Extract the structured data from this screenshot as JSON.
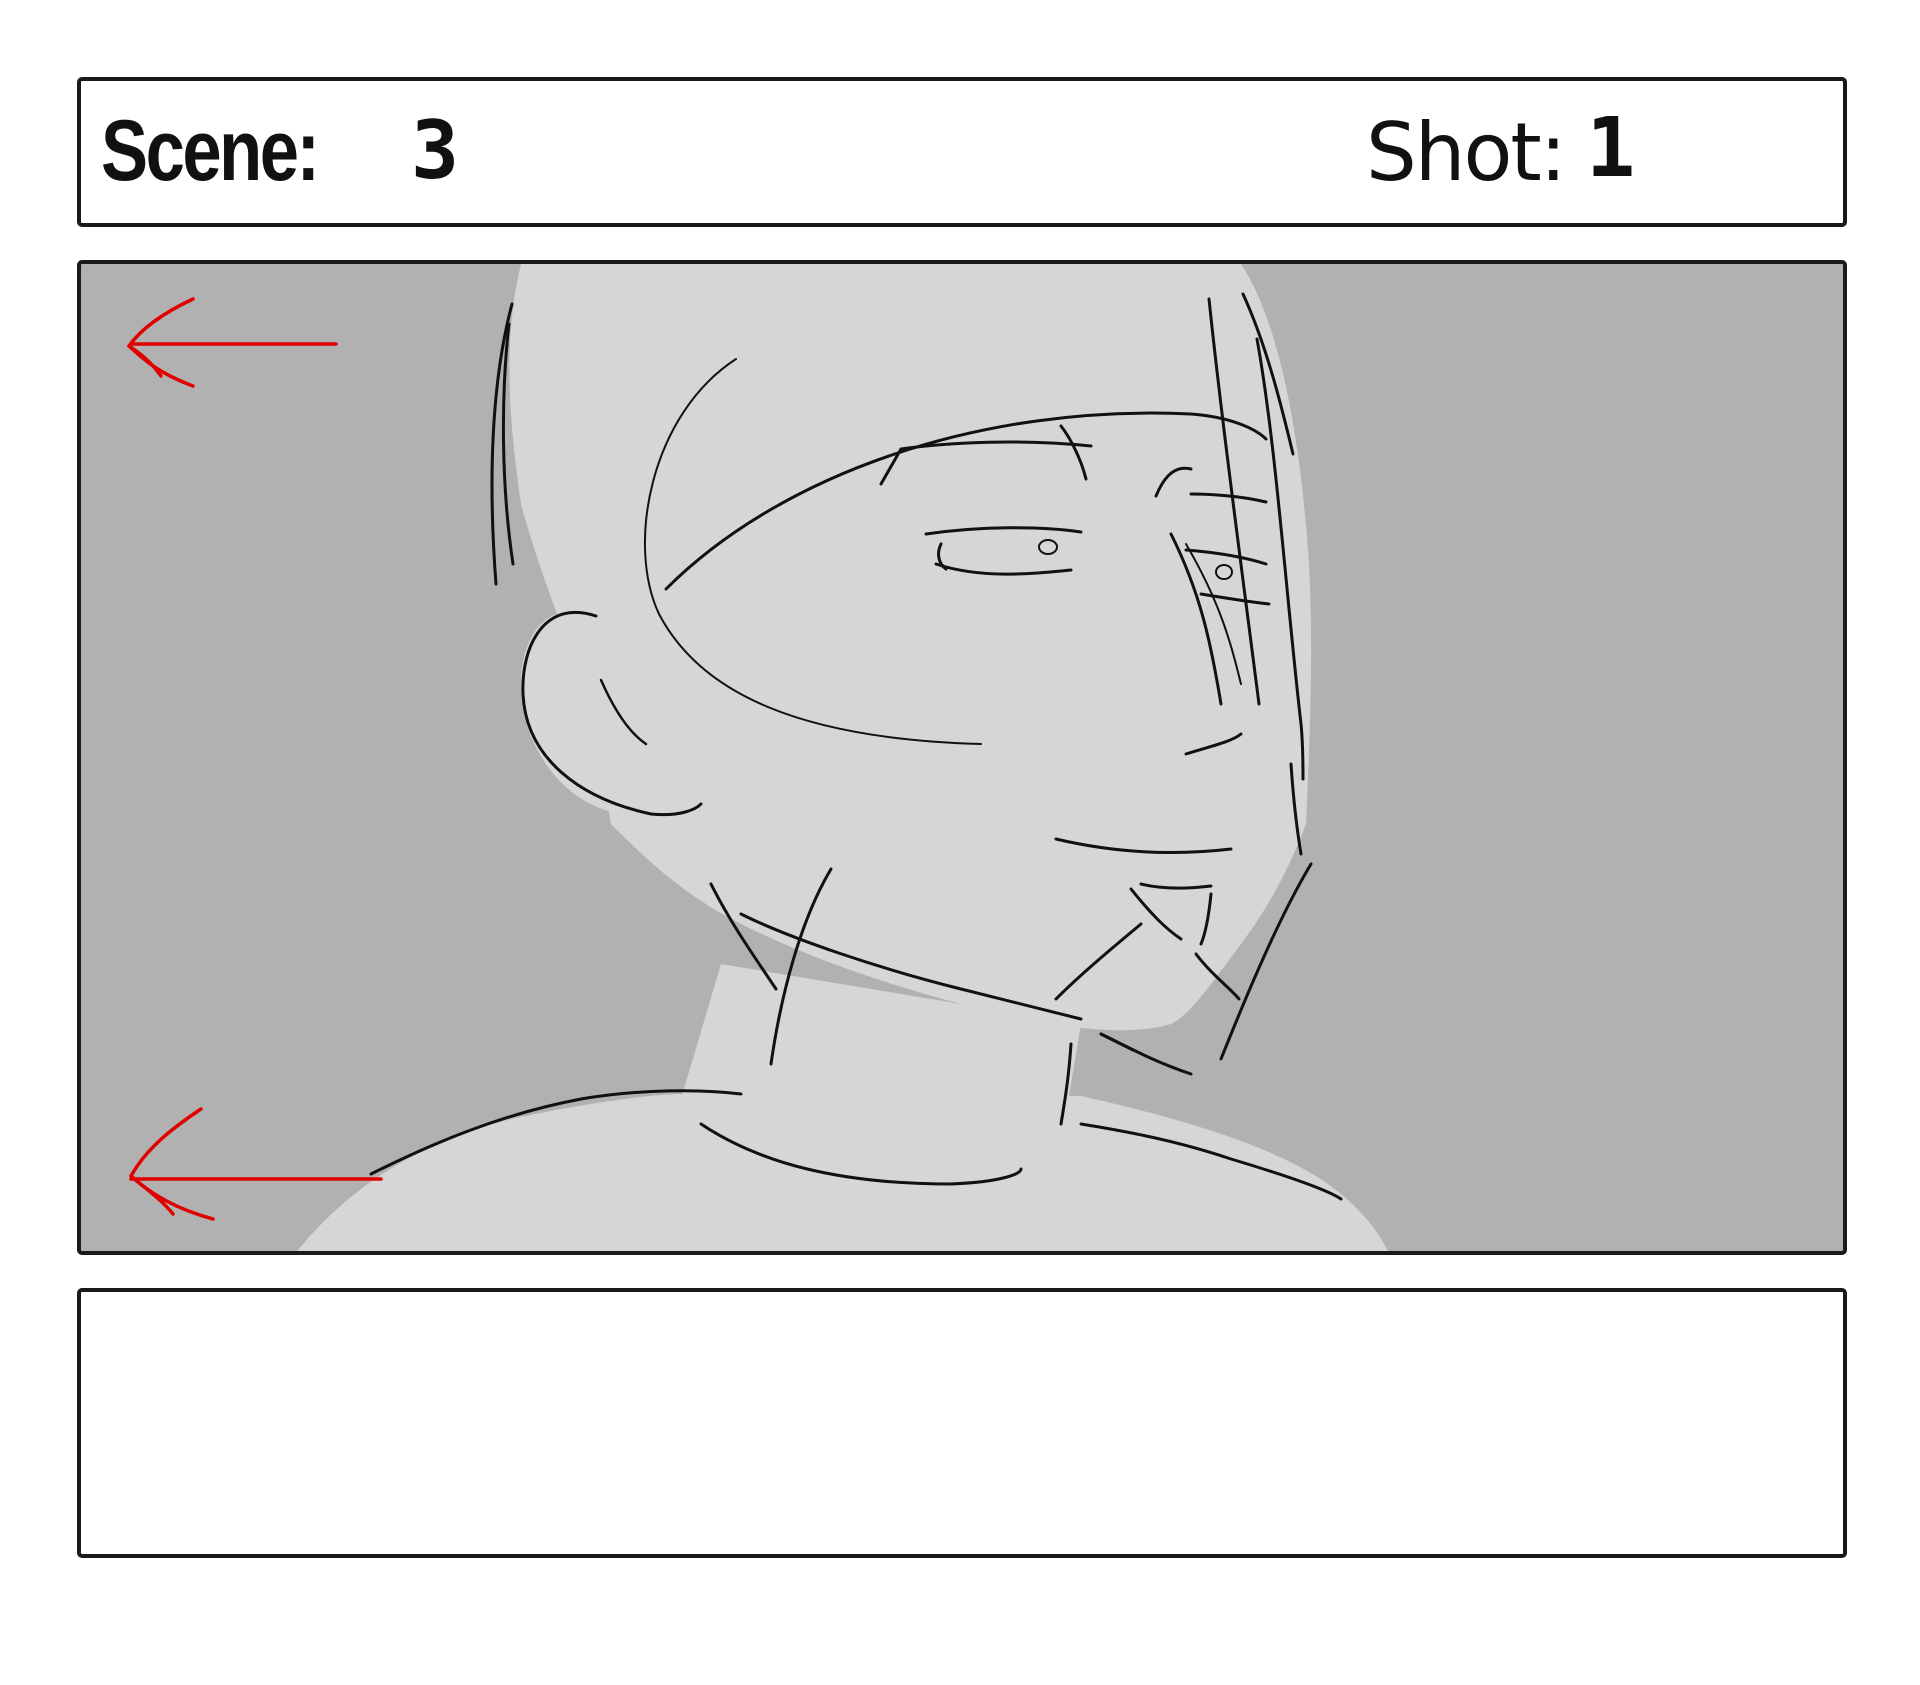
{
  "header": {
    "scene_label": "Scene:",
    "scene_number": "3",
    "shot_label": "Shot:",
    "shot_number": "1"
  },
  "frame": {
    "background_color": "#b1b1b1",
    "figure_fill_color": "#d6d6d6",
    "line_color": "#111111",
    "direction_arrow_color": "#e00000",
    "direction_arrows": [
      {
        "name": "top-left-arrow",
        "direction": "left"
      },
      {
        "name": "bottom-left-arrow",
        "direction": "left"
      }
    ]
  },
  "notes": {
    "text": ""
  }
}
